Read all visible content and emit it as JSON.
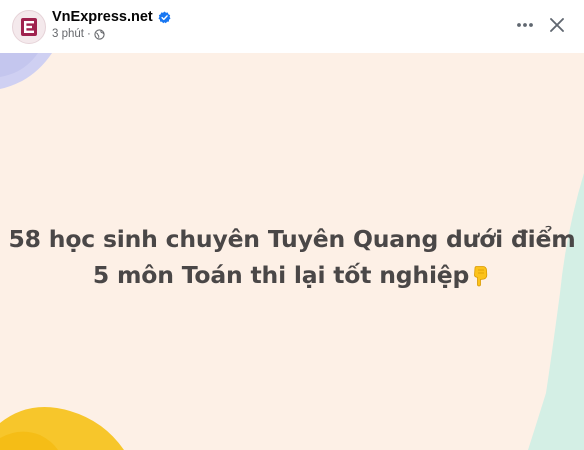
{
  "post": {
    "page_name": "VnExpress.net",
    "timestamp": "3 phút",
    "separator": "·",
    "audience_icon": "globe-icon",
    "verified_icon": "verified-badge-icon",
    "menu_icon": "more-options-icon",
    "close_icon": "close-icon"
  },
  "card": {
    "line1": "58 học sinh chuyên Tuyên Quang dưới điểm",
    "line2": "5 môn Toán thi lại tốt nghiệp",
    "emoji": "pointing-down-icon",
    "background_color": "#fdf0e6",
    "text_color": "#4a4747"
  },
  "colors": {
    "brand": "#9f224e",
    "verified": "#1877f2",
    "meta_text": "#65676b"
  }
}
